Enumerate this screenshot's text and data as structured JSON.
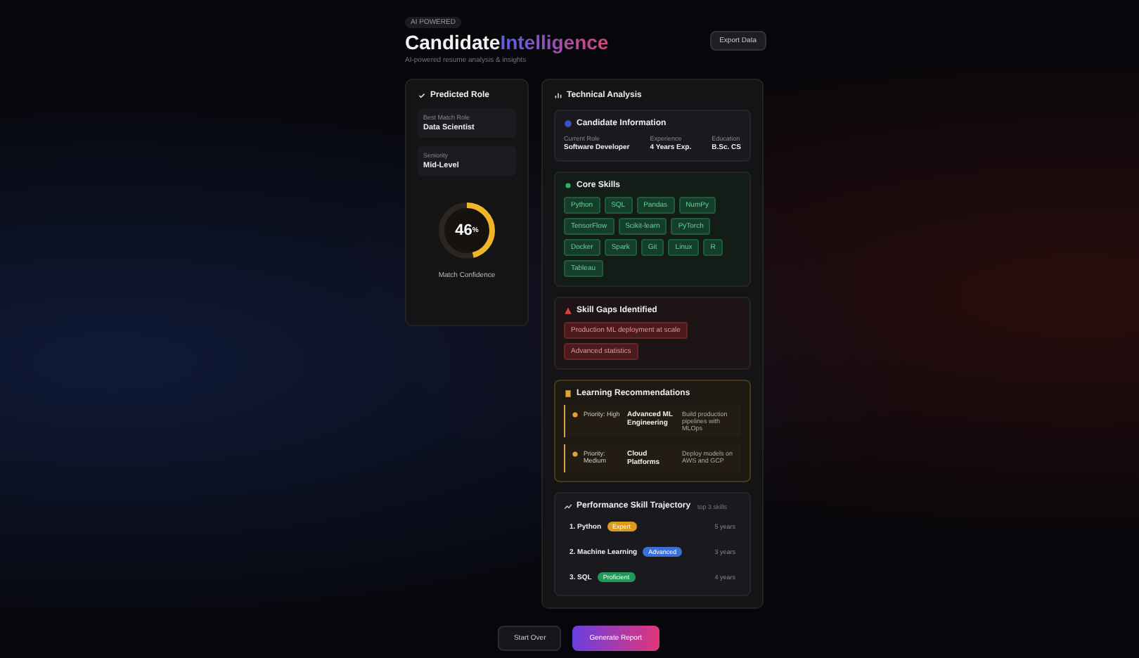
{
  "header": {
    "badge": "AI POWERED",
    "title_main": "Candidate",
    "title_accent": "Intelligence",
    "subtitle": "AI-powered resume analysis & insights",
    "export_button": "Export Data"
  },
  "predicted_role": {
    "title": "Predicted Role",
    "fields": [
      {
        "label": "Best Match Role",
        "value": "Data Scientist"
      },
      {
        "label": "Seniority",
        "value": "Mid-Level"
      }
    ],
    "score": "46",
    "score_unit": "%",
    "level": 0.46,
    "score_label": "Match Confidence"
  },
  "analysis": {
    "title": "Technical Analysis",
    "info": {
      "title": "Candidate Information",
      "columns": [
        {
          "label": "Current Role",
          "value": "Software Developer"
        },
        {
          "label": "Experience",
          "value": "4 Years Exp."
        },
        {
          "label": "Education",
          "value": "B.Sc. CS"
        }
      ]
    },
    "skills": {
      "title": "Core Skills",
      "chips": [
        "Python",
        "SQL",
        "Pandas",
        "NumPy",
        "TensorFlow",
        "Scikit-learn",
        "PyTorch",
        "Docker",
        "Spark",
        "Git",
        "Linux",
        "R",
        "Tableau"
      ]
    },
    "gaps": {
      "title": "Skill Gaps Identified",
      "chips": [
        "Production ML deployment at scale",
        "Advanced statistics"
      ]
    },
    "recommendations": {
      "title": "Learning Recommendations",
      "items": [
        {
          "priority": "Priority: High",
          "course": "Advanced ML Engineering",
          "description": "Build production pipelines with MLOps"
        },
        {
          "priority": "Priority: Medium",
          "course": "Cloud Platforms",
          "description": "Deploy models on AWS and GCP"
        }
      ]
    },
    "trajectory": {
      "title": "Performance Skill Trajectory",
      "note": "top 3 skills",
      "rows": [
        {
          "name": "1. Python",
          "badge": "Expert",
          "color": "#d99a1e",
          "detail": "5 years"
        },
        {
          "name": "2. Machine Learning",
          "badge": "Advanced",
          "color": "#3b6fd8",
          "detail": "3 years"
        },
        {
          "name": "3. SQL",
          "badge": "Proficient",
          "color": "#1f9a5a",
          "detail": "4 years"
        }
      ]
    }
  },
  "footer": {
    "secondary": "Start Over",
    "primary": "Generate Report"
  }
}
